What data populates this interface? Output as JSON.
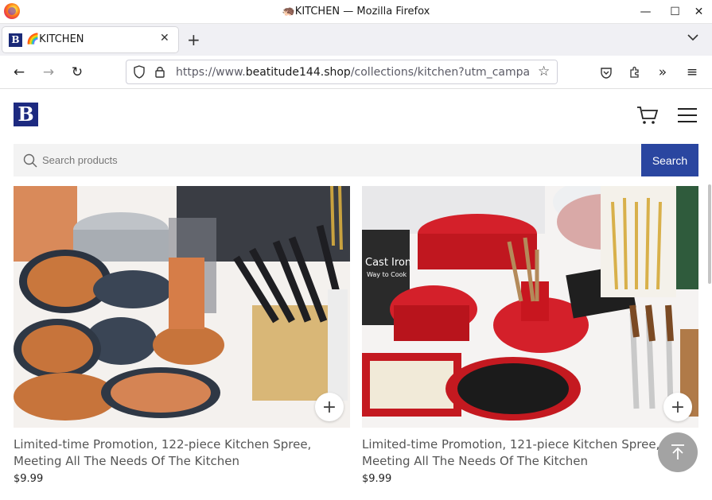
{
  "window": {
    "title": "🦔KITCHEN — Mozilla Firefox",
    "min": "—",
    "max": "☐",
    "close": "✕"
  },
  "tab": {
    "favicon": "B",
    "title": "🌈KITCHEN",
    "close": "✕",
    "new_tab": "+",
    "list": "⌄"
  },
  "nav": {
    "back": "←",
    "forward": "→",
    "reload": "↻",
    "url_prefix": "https://www.",
    "url_host": "beatitude144.shop",
    "url_path": "/collections/kitchen?utm_campa",
    "star": "☆",
    "pocket": "⛉",
    "extensions": "⚙",
    "overflow": "»",
    "menu": "≡"
  },
  "site": {
    "logo": "B",
    "search_placeholder": "Search products",
    "search_button": "Search",
    "accent": "#2a46a0",
    "logo_color": "#1d2a80"
  },
  "products": [
    {
      "name": "Limited-time Promotion, 122-piece Kitchen Spree, Meeting All The Needs Of The Kitchen",
      "price": "$9.99",
      "add": "+"
    },
    {
      "name": "Limited-time Promotion, 121-piece Kitchen Spree, Meeting All The Needs Of The Kitchen",
      "price": "$9.99",
      "add": "+",
      "book_title": "Cast Iron",
      "book_subtitle": "Way to Cook"
    }
  ]
}
